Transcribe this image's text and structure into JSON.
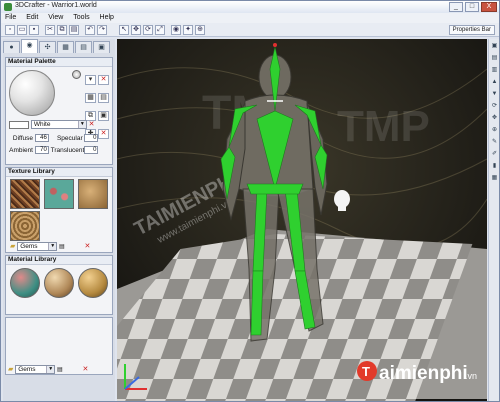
{
  "window": {
    "title": "3DCrafter - Warrior1.world",
    "buttons": {
      "minimize": "_",
      "maximize": "□",
      "close": "X"
    }
  },
  "menu": [
    "File",
    "Edit",
    "View",
    "Tools",
    "Help"
  ],
  "toolbar": {
    "properties_label": "Properties Bar"
  },
  "tabs": [
    "●",
    "◉",
    "✣",
    "▦",
    "▤",
    "▣"
  ],
  "material_palette": {
    "title": "Material Palette",
    "color_name": "White",
    "diffuse_label": "Diffuse",
    "diffuse_value": "46",
    "specular_label": "Specular",
    "specular_value": "0",
    "ambient_label": "Ambient",
    "ambient_value": "70",
    "translucent_label": "Translucent",
    "translucent_value": "0"
  },
  "texture_library": {
    "title": "Texture Library",
    "category": "Gems"
  },
  "material_library": {
    "title": "Material Library",
    "category": "Gems"
  },
  "viewport": {
    "watermark_text": "TMP",
    "watermark_brand": "TAIMIENPHI",
    "watermark_url": "www.taimienphi.vn",
    "logo_text": "aimienphi",
    "logo_suffix": ".vn",
    "logo_letter": "T"
  },
  "colors": {
    "bone_green": "#2fd02f",
    "floor_light": "#d9d7d3",
    "floor_dark": "#8f8d89",
    "viewport_bg": "#1c1a14"
  },
  "icons": [
    "undo-icon",
    "redo-icon",
    "select-icon",
    "move-icon",
    "rotate-icon",
    "scale-icon"
  ]
}
